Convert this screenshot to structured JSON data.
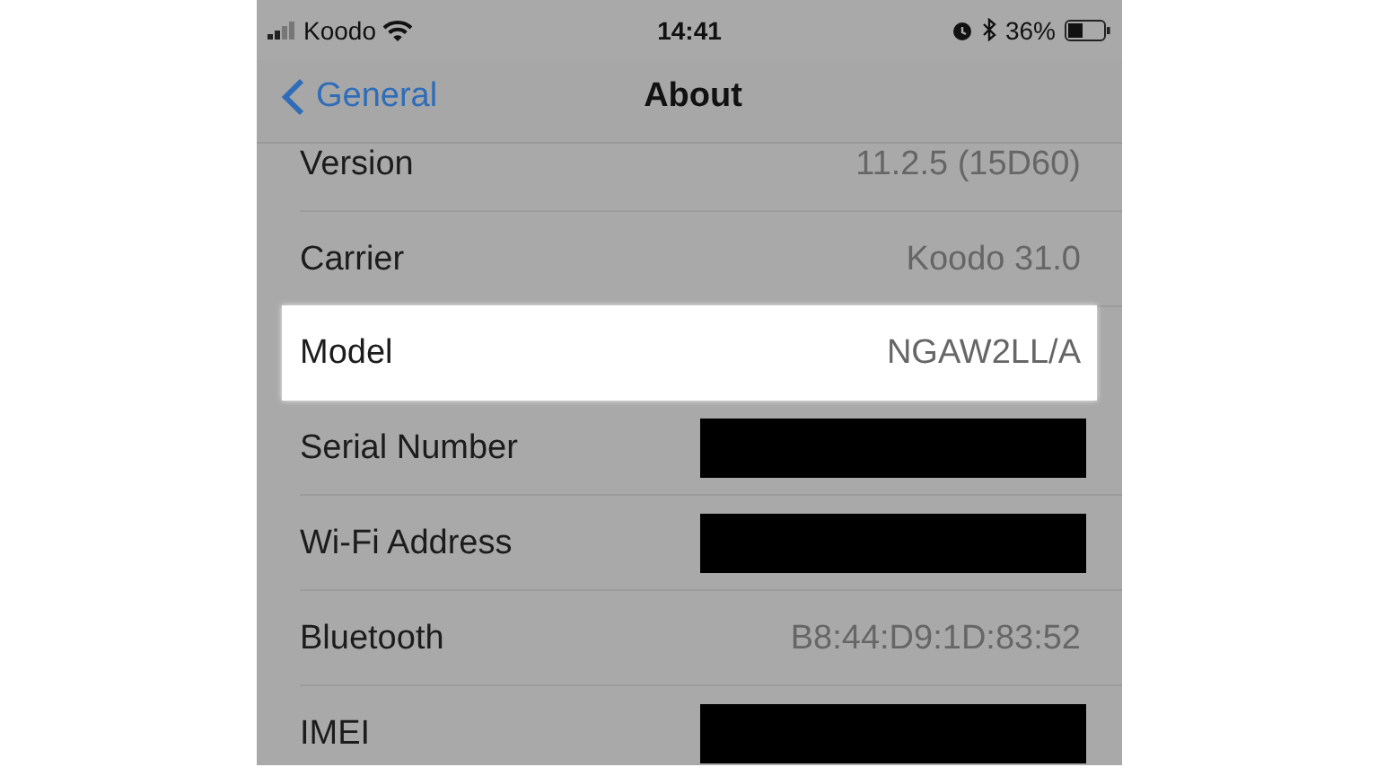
{
  "status_bar": {
    "carrier": "Koodo",
    "time": "14:41",
    "battery": "36%"
  },
  "nav_bar": {
    "back": "General",
    "title": "About"
  },
  "rows": [
    {
      "label": "Version",
      "value": "11.2.5 (15D60)",
      "kind": "text",
      "highlighted": false
    },
    {
      "label": "Carrier",
      "value": "Koodo 31.0",
      "kind": "text",
      "highlighted": false
    },
    {
      "label": "Model",
      "value": "NGAW2LL/A",
      "kind": "text",
      "highlighted": true
    },
    {
      "label": "Serial Number",
      "kind": "redacted",
      "highlighted": false
    },
    {
      "label": "Wi-Fi Address",
      "kind": "redacted",
      "highlighted": false
    },
    {
      "label": "Bluetooth",
      "value": "B8:44:D9:1D:83:52",
      "kind": "text",
      "highlighted": false
    },
    {
      "label": "IMEI",
      "kind": "redacted",
      "highlighted": false
    }
  ]
}
